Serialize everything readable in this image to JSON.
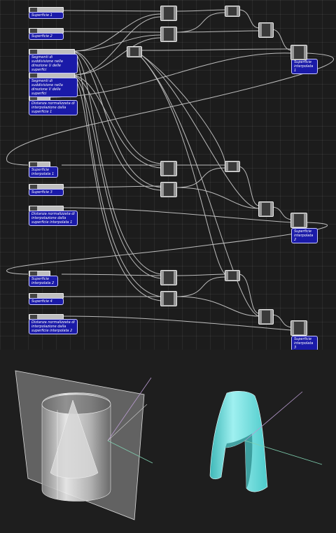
{
  "panels": {
    "superficie1": "Superficie 1",
    "superficie2": "Superficie 2",
    "segmenti_u": "Segmenti di suddivisione nella direzione U delle superfici",
    "segmenti_v": "Segmenti di suddivisione nella direzione V delle superfici",
    "distanza1": "Distanza normalizzata di interpolazione dalla superficie 1",
    "interpolato1_in": "Superficie interpolata 1",
    "superficie3": "Superficie 3",
    "distanza_interp1": "Distanza normalizzata di interpolazione dalla superficie interpolata 1",
    "interpolato2_in": "Superficie interpolata 2",
    "superficie4": "Superficie 4",
    "distanza_interp2": "Distanza normalizzata di interpolazione dalla superficie interpolata 2",
    "out1": "Superficie interpolata 1",
    "out2": "Superficie interpolata 2",
    "out3": "Superficie interpolata 3"
  },
  "colors": {
    "panel_bg": "#1a1aa8",
    "wire": "#d8d8d8",
    "surface_cyan": "#5fd6d6",
    "viewport_bg": "#1e1e1e"
  }
}
